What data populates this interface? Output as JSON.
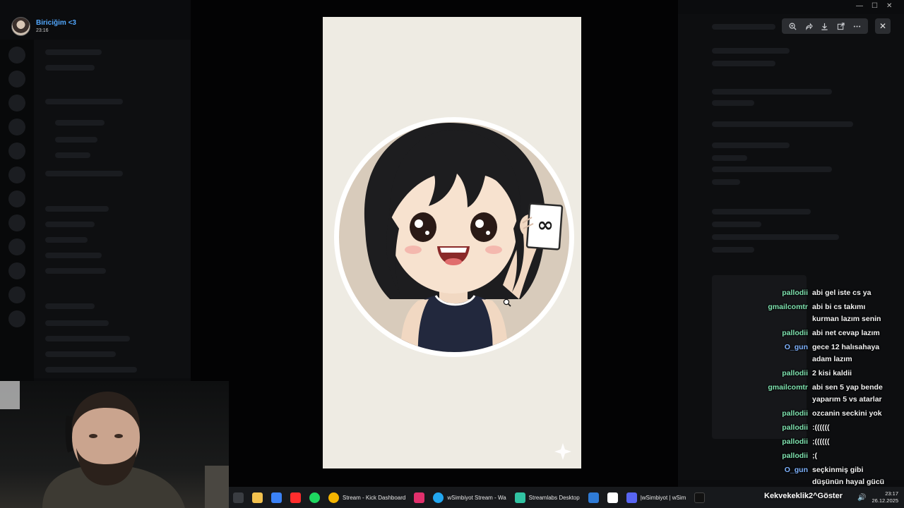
{
  "viewer": {
    "user_name": "Biriciğim <3",
    "time": "23:16"
  },
  "toolbar": {
    "zoom_icon": "zoom-in-icon",
    "forward_icon": "forward-icon",
    "download_icon": "download-icon",
    "popout_icon": "external-link-icon",
    "more_icon": "more-icon",
    "close_icon": "close-icon"
  },
  "image": {
    "card_symbol": "∞"
  },
  "stream_chat": [
    {
      "user": "pallodii",
      "color": "#7fe3b0",
      "message": "abi gel iste cs ya"
    },
    {
      "user": "gmailcomtr",
      "color": "#7fe3b0",
      "message": "abi bi cs takımı kurman lazım senin"
    },
    {
      "user": "pallodii",
      "color": "#7fe3b0",
      "message": "abi net cevap lazım"
    },
    {
      "user": "O_gun",
      "color": "#7fb3ff",
      "message": "gece 12 halısahaya adam lazım"
    },
    {
      "user": "pallodii",
      "color": "#7fe3b0",
      "message": "2 kisi kaldii"
    },
    {
      "user": "gmailcomtr",
      "color": "#7fe3b0",
      "message": "abi sen 5 yap bende yaparım 5 vs atarlar"
    },
    {
      "user": "pallodii",
      "color": "#7fe3b0",
      "message": "ozcanin seckini yok"
    },
    {
      "user": "pallodii",
      "color": "#7fe3b0",
      "message": ":(((((("
    },
    {
      "user": "pallodii",
      "color": "#7fe3b0",
      "message": ";(((((("
    },
    {
      "user": "pallodii",
      "color": "#7fe3b0",
      "message": ";("
    },
    {
      "user": "O_gun",
      "color": "#7fb3ff",
      "message": "seçkinmiş gibi düşünün hayal gücü önemlidir"
    }
  ],
  "taskbar": {
    "items": [
      {
        "icon": "files-icon",
        "color": "#3a3d42",
        "label": ""
      },
      {
        "icon": "folder-icon",
        "color": "#f2c14e",
        "label": ""
      },
      {
        "icon": "store-icon",
        "color": "#3b82f6",
        "label": ""
      },
      {
        "icon": "youtube-icon",
        "color": "#ff2d2d",
        "label": ""
      },
      {
        "icon": "spotify-icon",
        "color": "#1ed760",
        "label": ""
      },
      {
        "icon": "chrome-icon",
        "color": "#f4b400",
        "label": "Stream - Kick Dashboard"
      },
      {
        "icon": "instagram-icon",
        "color": "#e1306c",
        "label": ""
      },
      {
        "icon": "edge-icon",
        "color": "#22a7f0",
        "label": "wSimbiyot Stream - Wa"
      },
      {
        "icon": "streamlabs-icon",
        "color": "#31c3a2",
        "label": "Streamlabs Desktop"
      },
      {
        "icon": "outlook-icon",
        "color": "#2f7bd6",
        "label": ""
      },
      {
        "icon": "capcut-icon",
        "color": "#ffffff",
        "label": ""
      },
      {
        "icon": "discord-icon",
        "color": "#5865f2",
        "label": "|wSimbiyot | wSim"
      },
      {
        "icon": "tiktok-icon",
        "color": "#111111",
        "label": ""
      }
    ],
    "clock_time": "23:17",
    "clock_date": "26.12.2025",
    "overlay_text": "Kekvekeklik2^Göster"
  },
  "colors": {
    "accent": "#52a8ff",
    "chat_user_green": "#7fe3b0",
    "chat_user_blue": "#7fb3ff",
    "image_bg": "#eeebe3"
  }
}
